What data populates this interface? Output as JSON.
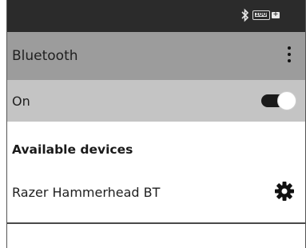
{
  "status_bar": {
    "bluetooth_icon": "bluetooth-icon",
    "battery_level": "100",
    "battery_tip_symbol": "+"
  },
  "app_bar": {
    "title": "Bluetooth",
    "menu_icon": "more-vert-icon"
  },
  "toggle": {
    "label": "On",
    "state": "on"
  },
  "available_devices": {
    "header": "Available devices",
    "devices": [
      {
        "name": "Razer Hammerhead BT",
        "settings_icon": "gear-icon"
      }
    ]
  },
  "colors": {
    "status_bar": "#2b2b2b",
    "app_bar": "#9c9c9c",
    "toggle_row": "#c4c4c4",
    "switch_track": "#1a1a1a"
  }
}
